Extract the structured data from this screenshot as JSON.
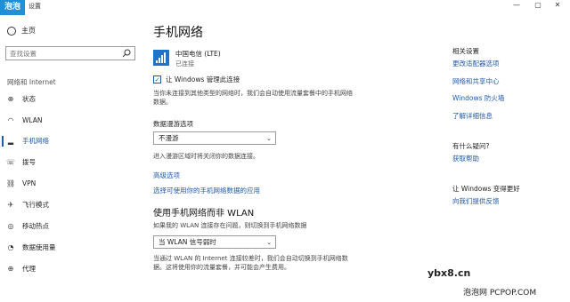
{
  "window": {
    "logo": "泡泡",
    "title": "设置",
    "minimize": "—",
    "maximize": "▢",
    "close": "✕"
  },
  "sidebar": {
    "home": "主页",
    "search_placeholder": "查找设置",
    "category": "网络和 Internet",
    "items": [
      {
        "label": "状态",
        "icon": "status-icon",
        "glyph": "⊕"
      },
      {
        "label": "WLAN",
        "icon": "wifi-icon",
        "glyph": "◠"
      },
      {
        "label": "手机网络",
        "icon": "cellular-icon",
        "glyph": "▂",
        "active": true
      },
      {
        "label": "拨号",
        "icon": "dialup-icon",
        "glyph": "☏"
      },
      {
        "label": "VPN",
        "icon": "vpn-icon",
        "glyph": "⛓"
      },
      {
        "label": "飞行模式",
        "icon": "airplane-icon",
        "glyph": "✈"
      },
      {
        "label": "移动热点",
        "icon": "hotspot-icon",
        "glyph": "◎"
      },
      {
        "label": "数据使用量",
        "icon": "data-usage-icon",
        "glyph": "◔"
      },
      {
        "label": "代理",
        "icon": "proxy-icon",
        "glyph": "⊕"
      }
    ]
  },
  "main": {
    "title": "手机网络",
    "carrier": "中国电信 (LTE)",
    "carrier_status": "已连接",
    "manage_label": "让 Windows 管理此连接",
    "manage_checked": true,
    "manage_desc": "当你未连接到其他类型的网络时，我们会自动使用流量套餐中的手机网络数据。",
    "roaming_heading": "数据漫游选项",
    "roaming_value": "不漫游",
    "roaming_desc": "进入漫游区域时将关闭你的数据连接。",
    "advanced_link": "高级选项",
    "apps_link": "选择可使用你的手机网络数据的应用",
    "fallback_heading": "使用手机网络而非 WLAN",
    "fallback_desc": "如果我的 WLAN 连接存在问题，则切换到手机网络数据",
    "fallback_value": "当 WLAN 信号弱时",
    "fallback_note": "当通过 WLAN 的 Internet 连接较差时，我们会自动切换到手机网络数据。这将使用你的流量套餐，并可能会产生费用。"
  },
  "right": {
    "related_title": "相关设置",
    "related_links": [
      "更改适配器选项",
      "网络和共享中心",
      "Windows 防火墙",
      "了解详细信息"
    ],
    "question_title": "有什么疑问?",
    "help_link": "获取帮助",
    "improve_title": "让 Windows 变得更好",
    "feedback_link": "向我们提供反馈"
  },
  "watermark": {
    "site": "ybx8.cn",
    "footer": "泡泡网 PCPOP.COM"
  }
}
